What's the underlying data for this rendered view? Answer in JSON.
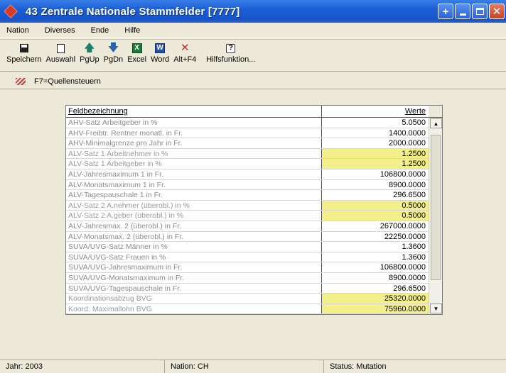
{
  "window": {
    "title": "43 Zentrale Nationale Stammfelder [7777]"
  },
  "menu": [
    {
      "label": "Nation"
    },
    {
      "label": "Diverses"
    },
    {
      "label": "Ende"
    },
    {
      "label": "Hilfe"
    }
  ],
  "toolbar": {
    "save": "Speichern",
    "select": "Auswahl",
    "pgup": "PgUp",
    "pgdn": "PgDn",
    "excel": "Excel",
    "word": "Word",
    "altf4": "Alt+F4",
    "help": "Hilfsfunktion..."
  },
  "tab": {
    "label": "F7=Quellensteuern"
  },
  "table": {
    "col_name": "Feldbezeichnung",
    "col_value": "Werte",
    "rows": [
      {
        "name": "AHV-Satz Arbeitgeber in %",
        "value": "5.0500",
        "highlight": false
      },
      {
        "name": "AHV-Freibtr. Rentner monatl. in Fr.",
        "value": "1400.0000",
        "highlight": false
      },
      {
        "name": "AHV-Minimalgrenze pro Jahr in Fr.",
        "value": "2000.0000",
        "highlight": false
      },
      {
        "name": "ALV-Satz 1 Arbeitnehmer in %",
        "value": "1.2500",
        "highlight": true
      },
      {
        "name": "ALV-Satz 1 Arbeitgeber in %",
        "value": "1.2500",
        "highlight": true
      },
      {
        "name": "ALV-Jahresmaximum  1 in Fr.",
        "value": "106800.0000",
        "highlight": false
      },
      {
        "name": "ALV-Monatsmaximum  1 in Fr.",
        "value": "8900.0000",
        "highlight": false
      },
      {
        "name": "ALV-Tagespauschale 1 in Fr.",
        "value": "296.6500",
        "highlight": false
      },
      {
        "name": "ALV-Satz 2 A.nehmer (überobl.) in %",
        "value": "0.5000",
        "highlight": true
      },
      {
        "name": "ALV-Satz 2 A.geber (überobl.) in %",
        "value": "0.5000",
        "highlight": true
      },
      {
        "name": "ALV-Jahresmax. 2 (überobl.) in Fr.",
        "value": "267000.0000",
        "highlight": false
      },
      {
        "name": "ALV-Monatsmax. 2 (überobl.) in Fr.",
        "value": "22250.0000",
        "highlight": false
      },
      {
        "name": "SUVA/UVG-Satz Männer in %",
        "value": "1.3600",
        "highlight": false
      },
      {
        "name": "SUVA/UVG-Satz Frauen in %",
        "value": "1.3600",
        "highlight": false
      },
      {
        "name": "SUVA/UVG-Jahresmaximum in Fr.",
        "value": "106800.0000",
        "highlight": false
      },
      {
        "name": "SUVA/UVG-Monatsmaximum in Fr.",
        "value": "8900.0000",
        "highlight": false
      },
      {
        "name": "SUVA/UVG-Tagespauschale in Fr.",
        "value": "296.6500",
        "highlight": false
      },
      {
        "name": "Koordinationsabzug BVG",
        "value": "25320.0000",
        "highlight": true
      },
      {
        "name": "Koord. Maximallohn BVG",
        "value": "75960.0000",
        "highlight": true
      }
    ]
  },
  "status": {
    "year": "Jahr: 2003",
    "nation": "Nation: CH",
    "state": "Status: Mutation"
  }
}
